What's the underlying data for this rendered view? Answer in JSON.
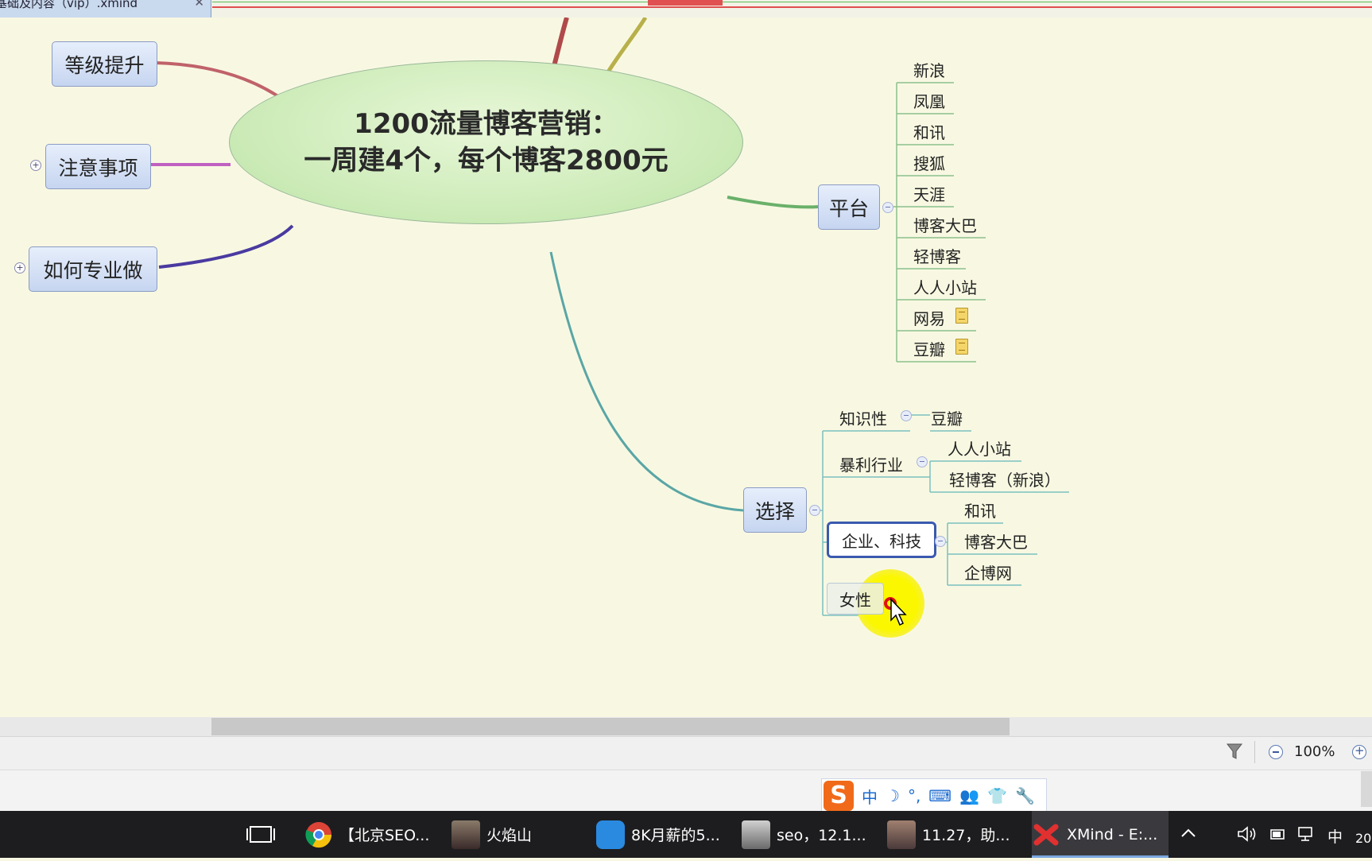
{
  "window": {
    "tab_title": "基础及内容（vip）.xmind",
    "tab_close": "✕"
  },
  "map": {
    "central": {
      "line1": "1200流量博客营销：",
      "line2": "一周建4个，每个博客2800元"
    },
    "left_topics": [
      {
        "label": "等级提升",
        "color": "#c0626a"
      },
      {
        "label": "注意事项",
        "collapsed": true,
        "color": "#c060c0"
      },
      {
        "label": "如何专业做",
        "collapsed": true,
        "color": "#4a3aa0"
      }
    ],
    "platform": {
      "label": "平台",
      "children": [
        "新浪",
        "凤凰",
        "和讯",
        "搜狐",
        "天涯",
        "博客大巴",
        "轻博客",
        "人人小站",
        "网易",
        "豆瓣"
      ],
      "notes_on": [
        "网易",
        "豆瓣"
      ],
      "color": "#6ab06a"
    },
    "choose": {
      "label": "选择",
      "color": "#5aa6a6",
      "children": [
        {
          "label": "知识性",
          "children": [
            "豆瓣"
          ]
        },
        {
          "label": "暴利行业",
          "children": [
            "人人小站",
            "轻博客（新浪）"
          ]
        },
        {
          "label": "企业、科技",
          "selected": true,
          "children": [
            "和讯",
            "博客大巴",
            "企博网"
          ]
        },
        {
          "label": "女性",
          "children": []
        }
      ]
    }
  },
  "statusbar": {
    "zoom": "100%",
    "filter_icon": "filter-icon"
  },
  "ime": {
    "logo": "S",
    "buttons": [
      "中",
      "☽",
      "°,",
      "⌨",
      "👥",
      "👕",
      "🔧"
    ]
  },
  "taskbar": {
    "items": [
      {
        "label": "【北京SEO...",
        "icon": "chrome-icon"
      },
      {
        "label": "火焰山",
        "icon": "avatar-icon"
      },
      {
        "label": "8K月薪的5...",
        "icon": "app-icon"
      },
      {
        "label": "seo，12.1...",
        "icon": "photo-icon"
      },
      {
        "label": "11.27，助...",
        "icon": "photo-icon"
      },
      {
        "label": "XMind - E:...",
        "icon": "xmind-icon"
      }
    ],
    "tray": {
      "ime_indicator": "中",
      "clock_partial": "20"
    }
  }
}
